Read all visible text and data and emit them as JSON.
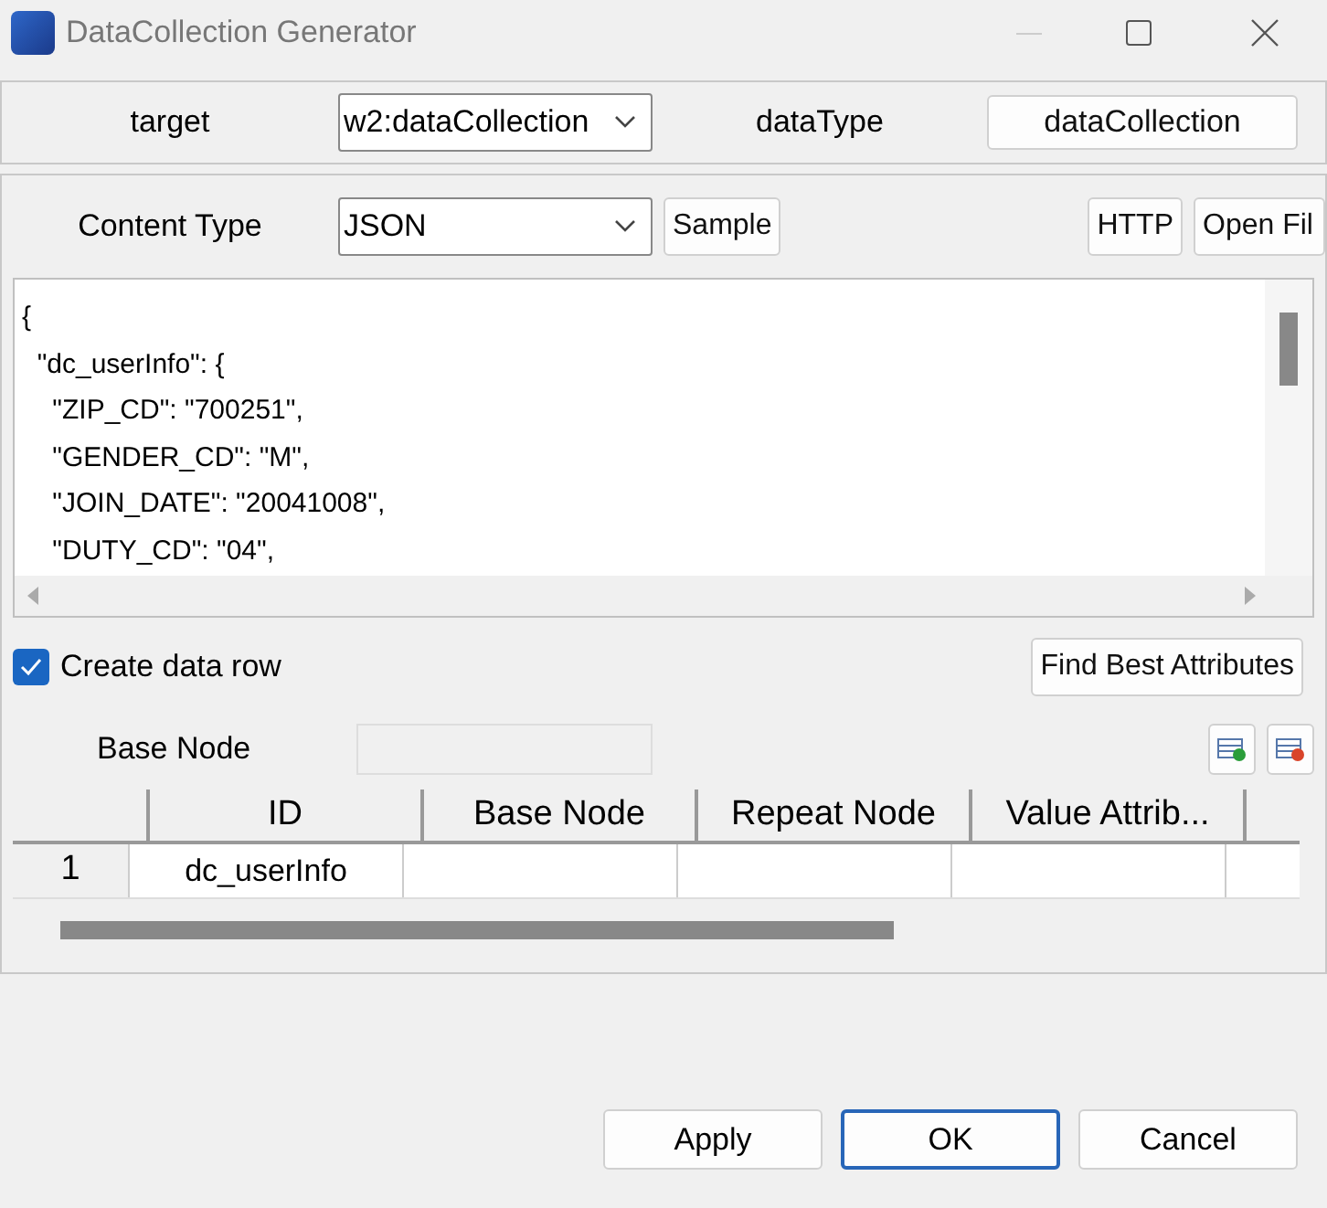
{
  "window": {
    "title": "DataCollection Generator"
  },
  "target": {
    "label": "target",
    "value": "w2:dataCollection",
    "data_type_label": "dataType",
    "data_type_value": "dataCollection"
  },
  "content": {
    "label": "Content Type",
    "value": "JSON",
    "sample_button": "Sample",
    "http_button": "HTTP",
    "open_file_button": "Open Fil",
    "code_lines": [
      "{",
      "  \"dc_userInfo\": {",
      "    \"ZIP_CD\": \"700251\",",
      "    \"GENDER_CD\": \"M\",",
      "    \"JOIN_DATE\": \"20041008\",",
      "    \"DUTY_CD\": \"04\","
    ]
  },
  "create_row": {
    "label": "Create data row",
    "checked": true
  },
  "find_button": "Find Best Attributes",
  "base_node": {
    "label": "Base Node"
  },
  "table": {
    "columns": [
      "ID",
      "Base Node",
      "Repeat Node",
      "Value Attrib..."
    ],
    "rows": [
      {
        "number": "1",
        "cells": [
          "dc_userInfo",
          "",
          "",
          ""
        ]
      }
    ]
  },
  "buttons": [
    "Apply",
    "OK",
    "Cancel"
  ]
}
